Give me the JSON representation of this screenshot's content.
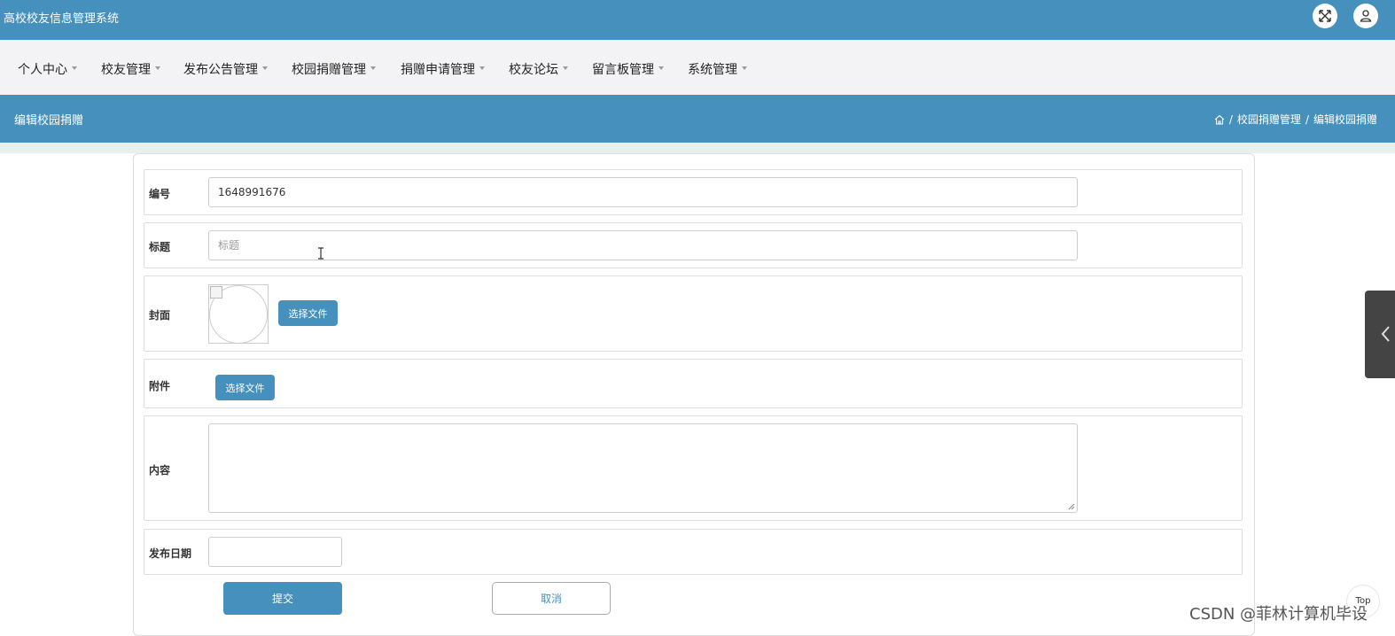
{
  "app": {
    "title": "高校校友信息管理系统"
  },
  "topbar": {
    "icons": [
      "fullscreen-icon",
      "user-icon"
    ]
  },
  "nav": {
    "items": [
      {
        "label": "个人中心"
      },
      {
        "label": "校友管理"
      },
      {
        "label": "发布公告管理"
      },
      {
        "label": "校园捐赠管理"
      },
      {
        "label": "捐赠申请管理"
      },
      {
        "label": "校友论坛"
      },
      {
        "label": "留言板管理"
      },
      {
        "label": "系统管理"
      }
    ]
  },
  "page": {
    "title": "编辑校园捐赠",
    "breadcrumb": {
      "sep": "/",
      "parent": "校园捐赠管理",
      "current": "编辑校园捐赠"
    }
  },
  "form": {
    "id": {
      "label": "编号",
      "value": "1648991676"
    },
    "title": {
      "label": "标题",
      "placeholder": "标题"
    },
    "cover": {
      "label": "封面",
      "button": "选择文件"
    },
    "attachment": {
      "label": "附件",
      "button": "选择文件"
    },
    "content": {
      "label": "内容"
    },
    "date": {
      "label": "发布日期"
    },
    "submit": "提交",
    "cancel": "取消"
  },
  "floating": {
    "top_label": "Top"
  },
  "watermark": "CSDN @菲林计算机毕设",
  "colors": {
    "primary": "#4590bc",
    "nav_bg": "#f3f3f5",
    "side_tab": "#444444"
  }
}
